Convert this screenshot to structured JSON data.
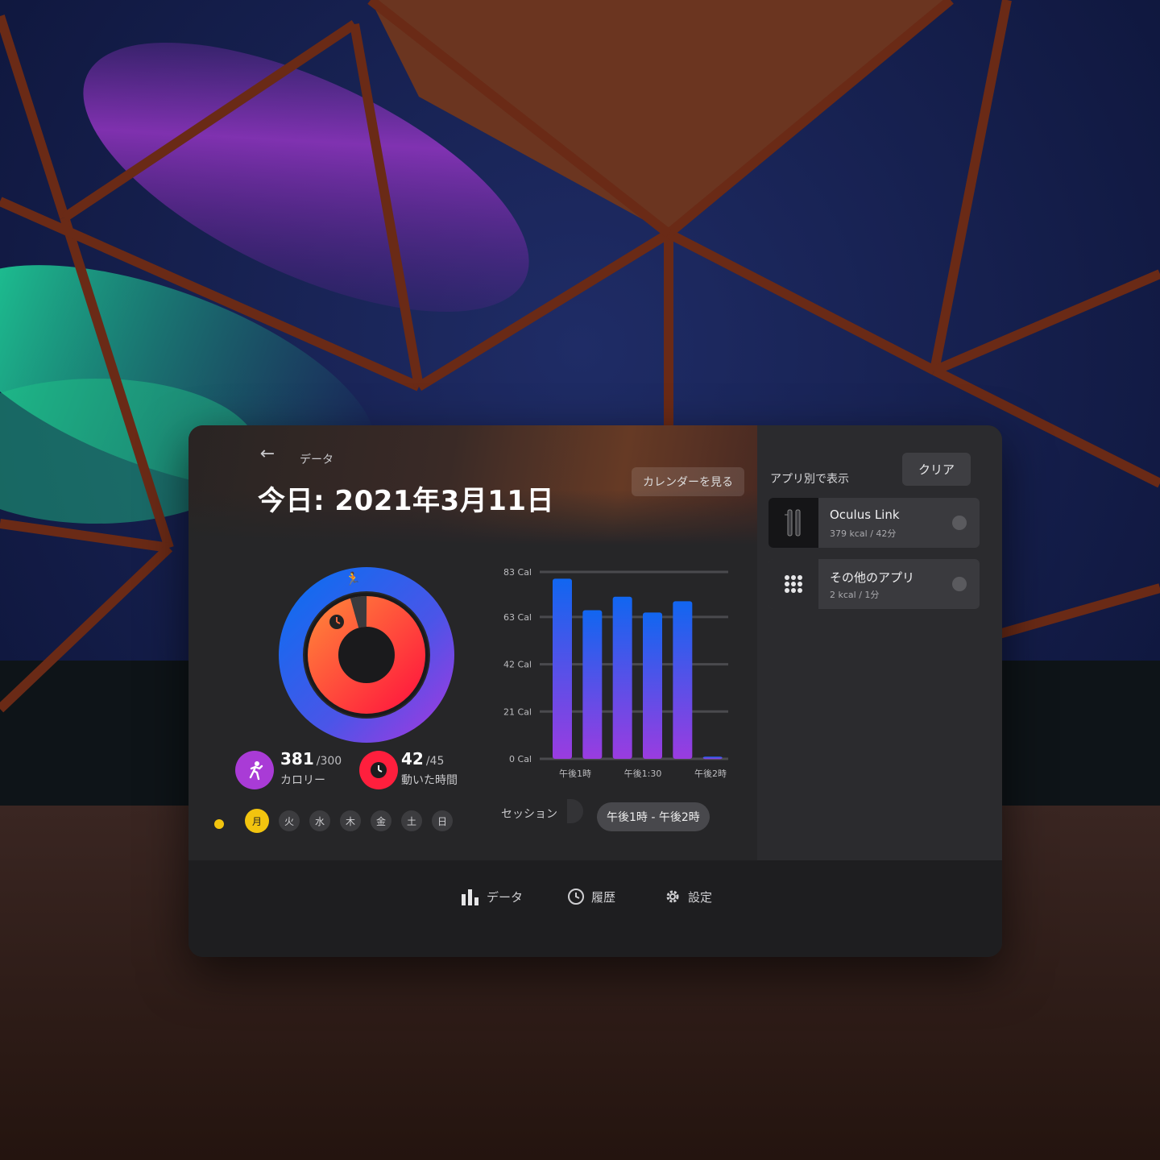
{
  "header": {
    "back_icon": "arrow-left-icon",
    "breadcrumb": "データ",
    "title": "今日: 2021年3月11日",
    "calendar_button": "カレンダーを見る"
  },
  "ring": {
    "calories_progress": 1.27,
    "time_progress": 0.93,
    "calories_color": "#7a3cf0",
    "time_color": "#ff2a3b"
  },
  "stats": {
    "calories": {
      "value": "381",
      "goal": "/300",
      "label": "カロリー",
      "icon": "running-person-icon",
      "color": "#a93bd6"
    },
    "time": {
      "value": "42",
      "goal": "/45",
      "label": "動いた時間",
      "icon": "clock-icon",
      "color": "#ff1f3d"
    }
  },
  "days": {
    "items": [
      "月",
      "火",
      "水",
      "木",
      "金",
      "土",
      "日"
    ],
    "selected": 0
  },
  "chart_data": {
    "type": "bar",
    "categories": [
      "1",
      "2",
      "3",
      "4",
      "5",
      "6"
    ],
    "values": [
      80,
      66,
      72,
      65,
      70,
      1
    ],
    "yticks": [
      "83 Cal",
      "63 Cal",
      "42 Cal",
      "21 Cal",
      "0 Cal"
    ],
    "ytick_values": [
      83,
      63,
      42,
      21,
      0
    ],
    "xlabels": [
      "午後1時",
      "午後1:30",
      "午後2時"
    ],
    "ylim": [
      0,
      83
    ],
    "colors": {
      "top": "#1166f0",
      "bottom": "#9a3ce0"
    }
  },
  "session": {
    "label": "セッション",
    "selected": "午後1時 - 午後2時"
  },
  "sidebar": {
    "title": "アプリ別で表示",
    "clear_button": "クリア",
    "apps": [
      {
        "name": "Oculus Link",
        "meta": "379 kcal / 42分",
        "icon": "link-cable-icon"
      },
      {
        "name": "その他のアプリ",
        "meta": "2 kcal / 1分",
        "icon": "app-grid-icon"
      }
    ]
  },
  "nav": {
    "items": [
      {
        "label": "データ",
        "icon": "bar-chart-icon"
      },
      {
        "label": "履歴",
        "icon": "history-icon"
      },
      {
        "label": "設定",
        "icon": "gear-icon"
      }
    ]
  }
}
